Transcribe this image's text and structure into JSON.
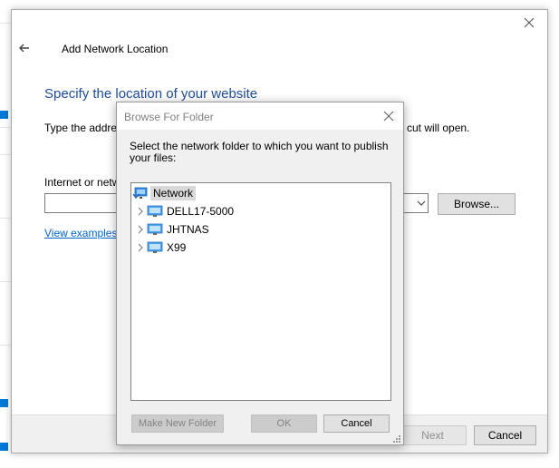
{
  "wizard": {
    "title": "Add Network Location",
    "heading": "Specify the location of your website",
    "description_start": "Type the addre",
    "description_end": "cut will open.",
    "input_label": "Internet or netw",
    "input_value": "",
    "browse_label": "Browse...",
    "examples_link": "View examples",
    "next_label": "Next",
    "cancel_label": "Cancel",
    "close_icon": "close-icon",
    "back_icon": "back-arrow-icon"
  },
  "dialog": {
    "title": "Browse For Folder",
    "instructions": "Select the network folder to which you want to publish your files:",
    "tree": {
      "root": {
        "label": "Network",
        "icon": "network-icon"
      },
      "children": [
        {
          "label": "DELL17-5000",
          "icon": "computer-icon"
        },
        {
          "label": "JHTNAS",
          "icon": "computer-icon"
        },
        {
          "label": "X99",
          "icon": "computer-icon"
        }
      ]
    },
    "new_folder_label": "Make New Folder",
    "ok_label": "OK",
    "cancel_label": "Cancel"
  },
  "colors": {
    "heading": "#1e4e99",
    "link": "#0066cc",
    "accent": "#0078d7"
  }
}
